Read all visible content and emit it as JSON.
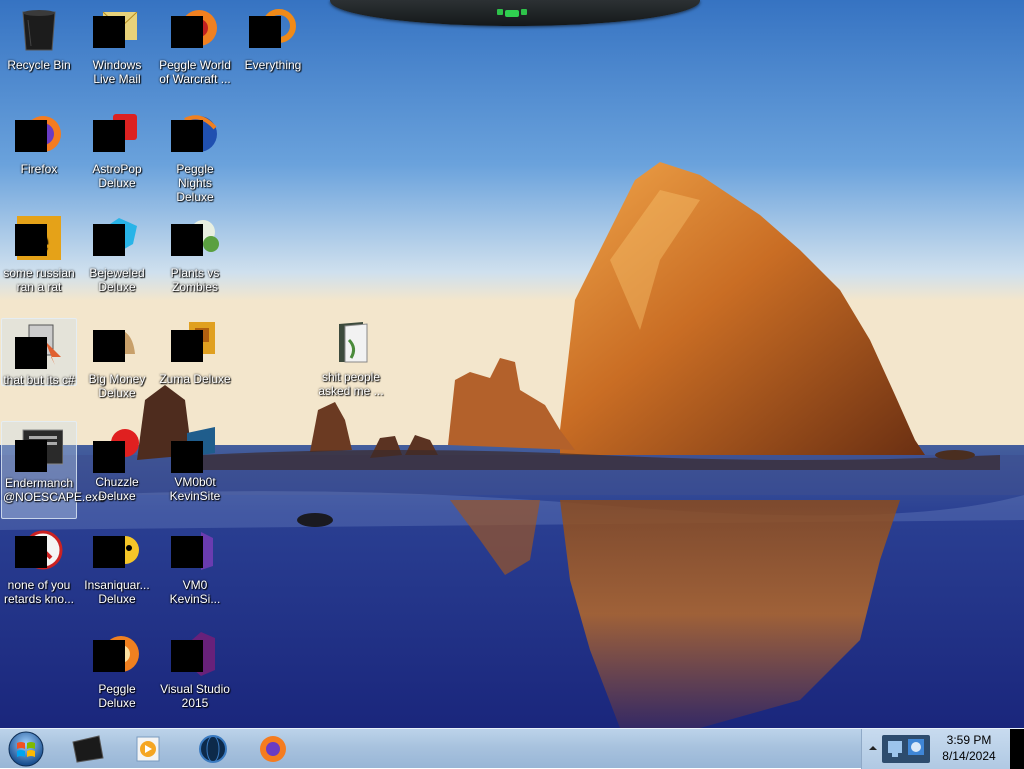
{
  "desktop": {
    "icons": [
      {
        "label": "Recycle Bin",
        "icon": "recycle-bin-icon"
      },
      {
        "label": "Windows Live Mail",
        "icon": "windows-live-mail-icon"
      },
      {
        "label": "Peggle World of Warcraft ...",
        "icon": "peggle-wow-icon"
      },
      {
        "label": "Everything",
        "icon": "everything-search-icon"
      },
      {
        "label": "Firefox",
        "icon": "firefox-icon"
      },
      {
        "label": "AstroPop Deluxe",
        "icon": "astropop-icon"
      },
      {
        "label": "Peggle Nights Deluxe",
        "icon": "peggle-nights-icon"
      },
      {
        "label": "some russian ran a rat",
        "icon": "russian-rat-icon"
      },
      {
        "label": "Bejeweled Deluxe",
        "icon": "bejeweled-icon"
      },
      {
        "label": "Plants vs Zombies",
        "icon": "plants-vs-zombies-icon"
      },
      {
        "label": "that but its c#",
        "icon": "shortcut-cursor-icon"
      },
      {
        "label": "Big Money Deluxe",
        "icon": "big-money-icon"
      },
      {
        "label": "Zuma Deluxe",
        "icon": "zuma-icon"
      },
      {
        "label": "shit people asked me ...",
        "icon": "folder-icon"
      },
      {
        "label": "Endermanch @NOESCAPE.exe",
        "icon": "noescape-exe-icon"
      },
      {
        "label": "Chuzzle Deluxe",
        "icon": "chuzzle-icon"
      },
      {
        "label": "VM0b0t KevinSite",
        "icon": "vm0b0t-icon"
      },
      {
        "label": "none of you retards kno...",
        "icon": "shortcut-red-icon"
      },
      {
        "label": "Insaniquar... Deluxe",
        "icon": "insaniquarium-icon"
      },
      {
        "label": "VM0 KevinSi...",
        "icon": "vm0-icon"
      },
      {
        "label": "Peggle Deluxe",
        "icon": "peggle-deluxe-icon"
      },
      {
        "label": "Visual Studio 2015",
        "icon": "visual-studio-icon"
      }
    ]
  },
  "taskbar": {
    "start": "windows-start-orb-icon",
    "pinned": [
      "black-folder-icon",
      "media-player-icon",
      "globe-icon",
      "firefox-icon"
    ]
  },
  "tray": {
    "time": "3:59 PM",
    "date": "8/14/2024"
  },
  "colors": {
    "taskbar": "#a8c2de",
    "sky_top": "#3a78c6",
    "water": "#1d2f8a"
  }
}
